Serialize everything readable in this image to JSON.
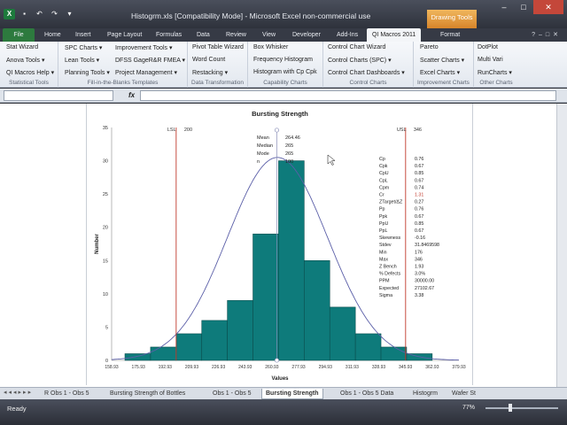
{
  "window": {
    "title": "Histogrm.xls  [Compatibility Mode]  -  Microsoft Excel non-commercial use",
    "contextual_tab_group": "Drawing Tools"
  },
  "ribbon_tabs": [
    "File",
    "Home",
    "Insert",
    "Page Layout",
    "Formulas",
    "Data",
    "Review",
    "View",
    "Developer",
    "Add-Ins",
    "QI Macros 2011",
    "Format"
  ],
  "ribbon_groups": [
    {
      "label": "Statistical Tools",
      "commands": [
        "Stat Wizard",
        "Anova Tools ▾",
        "QI Macros Help ▾"
      ]
    },
    {
      "label": "Fill-in-the-Blanks Templates",
      "commands": [
        "SPC Charts ▾",
        "Lean Tools ▾",
        "Planning Tools ▾",
        "Improvement Tools ▾",
        "DFSS GageR&R FMEA ▾",
        "Project Management ▾"
      ]
    },
    {
      "label": "Data Transformation",
      "commands": [
        "Pivot Table Wizard",
        "Word Count",
        "Restacking ▾"
      ]
    },
    {
      "label": "Capability Charts",
      "commands": [
        "Box Whisker",
        "Frequency Histogram",
        "Histogram with Cp Cpk"
      ]
    },
    {
      "label": "Control Charts",
      "commands": [
        "Control Chart Wizard",
        "Control Charts (SPC) ▾",
        "Control Chart Dashboards ▾"
      ]
    },
    {
      "label": "Improvement Charts",
      "commands": [
        "Pareto",
        "Scatter Charts ▾",
        "Excel Charts ▾"
      ]
    },
    {
      "label": "Other Charts",
      "commands": [
        "DotPlot",
        "Multi Vari",
        "RunCharts ▾"
      ]
    }
  ],
  "formula_bar": {
    "fx": "fx",
    "name_box": "",
    "value": ""
  },
  "sheet_tabs": [
    "R Obs 1 - Obs 5",
    "Bursting Strength of Bottles",
    "Obs 1 - Obs 5",
    "Bursting Strength",
    "Obs 1 - Obs 5 Data",
    "Histogrm",
    "Wafer St"
  ],
  "active_sheet": "Bursting Strength",
  "status": {
    "ready": "Ready",
    "zoom": "77%"
  },
  "chart_data": {
    "type": "bar",
    "title": "Bursting Strength",
    "xlabel": "Values",
    "ylabel": "Number",
    "ylim": [
      0,
      35
    ],
    "yticks": [
      0,
      5,
      10,
      15,
      20,
      25,
      30,
      35
    ],
    "xticks": [
      "158.93",
      "175.93",
      "192.93",
      "209.93",
      "226.93",
      "243.93",
      "260.93",
      "277.93",
      "294.93",
      "311.93",
      "328.93",
      "345.93",
      "362.93",
      "379.93"
    ],
    "bar_edges": [
      167.4,
      362.93
    ],
    "values": [
      1,
      2,
      4,
      6,
      9,
      19,
      30,
      15,
      8,
      4,
      2,
      1
    ],
    "curve": "normal",
    "lsl": {
      "label": "LSL",
      "value": 200
    },
    "usl": {
      "label": "USL",
      "value": 346
    },
    "mean_line": 264.06,
    "center_stats": [
      {
        "label": "Mean",
        "value": "264.46"
      },
      {
        "label": "Median",
        "value": "265"
      },
      {
        "label": "Mode",
        "value": "265"
      },
      {
        "label": "n",
        "value": "100"
      }
    ],
    "capability_stats": [
      {
        "label": "Cp",
        "value": "0.76"
      },
      {
        "label": "Cpk",
        "value": "0.67"
      },
      {
        "label": "CpU",
        "value": "0.85"
      },
      {
        "label": "CpL",
        "value": "0.67"
      },
      {
        "label": "Cpm",
        "value": "0.74"
      },
      {
        "label": "Cr",
        "value": "1.31",
        "highlight": true
      },
      {
        "label": "ZTarget/ΔZ",
        "value": "0.27"
      },
      {
        "label": "Pp",
        "value": "0.76"
      },
      {
        "label": "Ppk",
        "value": "0.67"
      },
      {
        "label": "PpU",
        "value": "0.85"
      },
      {
        "label": "PpL",
        "value": "0.67"
      },
      {
        "label": "Skewness",
        "value": "-0.16"
      },
      {
        "label": "Stdev",
        "value": "31.8469598"
      },
      {
        "label": "Min",
        "value": "176"
      },
      {
        "label": "Max",
        "value": "346"
      },
      {
        "label": "Z Bench",
        "value": "1.93"
      },
      {
        "label": "% Defects",
        "value": "3.0%"
      },
      {
        "label": "PPM",
        "value": "30000.00"
      },
      {
        "label": "Expected",
        "value": "27102.67"
      },
      {
        "label": "Sigma",
        "value": "3.38"
      }
    ],
    "colors": {
      "bar": "#0e7b7b",
      "curve": "#5b5fa8",
      "spec_line": "#c0392b",
      "highlight": "#c0392b"
    }
  }
}
